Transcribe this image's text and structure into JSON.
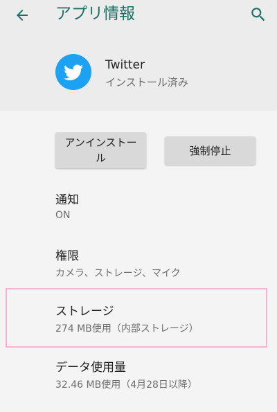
{
  "header": {
    "title": "アプリ情報",
    "back_icon": "arrow-back-icon",
    "search_icon": "search-icon",
    "accent_color": "#1f6f64"
  },
  "app": {
    "name": "Twitter",
    "status": "インストール済み",
    "icon": "twitter-bird-icon",
    "icon_color": "#1da1f2"
  },
  "buttons": {
    "uninstall_label": "アンインストール",
    "force_stop_label": "強制停止"
  },
  "settings": {
    "notifications": {
      "title": "通知",
      "summary": "ON"
    },
    "permissions": {
      "title": "権限",
      "summary": "カメラ、ストレージ、マイク"
    },
    "storage": {
      "title": "ストレージ",
      "summary": "274 MB使用（内部ストレージ）"
    },
    "data_usage": {
      "title": "データ使用量",
      "summary": "32.46 MB使用（4月28日以降）"
    }
  }
}
